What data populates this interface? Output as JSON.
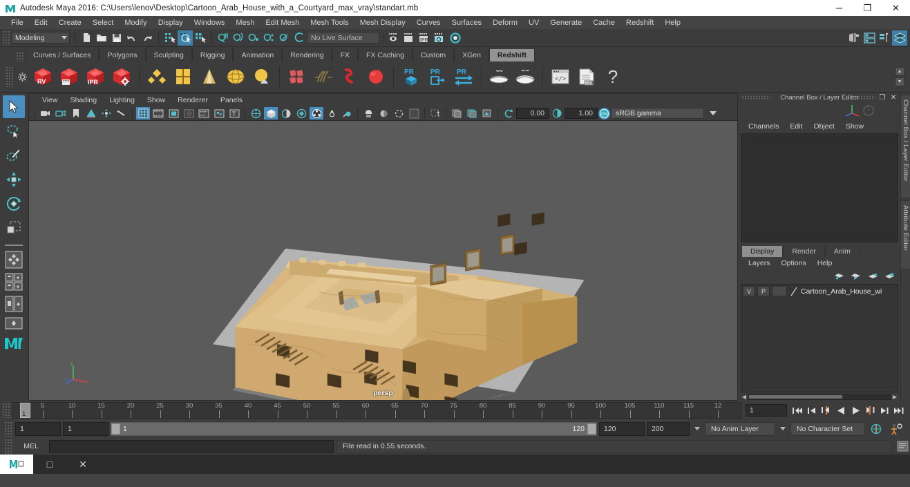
{
  "titlebar": {
    "text": "Autodesk Maya 2016: C:\\Users\\lenov\\Desktop\\Cartoon_Arab_House_with_a_Courtyard_max_vray\\standart.mb",
    "icon": "maya-app-icon",
    "minimize": "─",
    "maximize": "❐",
    "close": "✕"
  },
  "menubar": {
    "items": [
      {
        "label": "File"
      },
      {
        "label": "Edit"
      },
      {
        "label": "Create"
      },
      {
        "label": "Select"
      },
      {
        "label": "Modify"
      },
      {
        "label": "Display"
      },
      {
        "label": "Windows"
      },
      {
        "label": "Mesh"
      },
      {
        "label": "Edit Mesh"
      },
      {
        "label": "Mesh Tools"
      },
      {
        "label": "Mesh Display"
      },
      {
        "label": "Curves"
      },
      {
        "label": "Surfaces"
      },
      {
        "label": "Deform"
      },
      {
        "label": "UV"
      },
      {
        "label": "Generate"
      },
      {
        "label": "Cache"
      },
      {
        "label": "Redshift"
      },
      {
        "label": "Help"
      }
    ]
  },
  "statusbar": {
    "menuset": "Modeling",
    "live_surface": "No Live Surface",
    "icons": [
      "new-scene-icon",
      "open-scene-icon",
      "save-scene-icon",
      "undo-icon",
      "redo-icon",
      "select-by-hierarchy-icon",
      "select-by-object-icon",
      "select-by-component-icon",
      "snap-to-grid-icon",
      "snap-to-curve-icon",
      "snap-to-point-icon",
      "snap-to-projected-center-icon",
      "snap-to-view-plane-icon",
      "make-live-icon",
      "show-render-view-icon",
      "render-current-frame-icon",
      "ipr-render-icon",
      "render-settings-icon",
      "hypershade-icon",
      "toggle-sidebar-icon",
      "attribute-editor-icon",
      "tool-settings-icon",
      "channel-box-icon"
    ]
  },
  "shelf": {
    "tabs": [
      {
        "label": "Curves / Surfaces",
        "active": false
      },
      {
        "label": "Polygons",
        "active": false
      },
      {
        "label": "Sculpting",
        "active": false
      },
      {
        "label": "Rigging",
        "active": false
      },
      {
        "label": "Animation",
        "active": false
      },
      {
        "label": "Rendering",
        "active": false
      },
      {
        "label": "FX",
        "active": false
      },
      {
        "label": "FX Caching",
        "active": false
      },
      {
        "label": "Custom",
        "active": false
      },
      {
        "label": "XGen",
        "active": false
      },
      {
        "label": "Redshift",
        "active": true
      }
    ],
    "buttons": [
      {
        "name": "redshift-render-view-icon",
        "badge": "RV"
      },
      {
        "name": "redshift-render-sequence-icon",
        "badge": ""
      },
      {
        "name": "redshift-ipr-icon",
        "badge": "IPR"
      },
      {
        "name": "redshift-render-settings-icon",
        "badge": ""
      },
      {
        "name": "redshift-area-light-icon",
        "badge": ""
      },
      {
        "name": "redshift-portal-light-icon",
        "badge": ""
      },
      {
        "name": "redshift-ies-light-icon",
        "badge": ""
      },
      {
        "name": "redshift-dome-light-icon",
        "badge": ""
      },
      {
        "name": "redshift-physical-sun-icon",
        "badge": ""
      },
      {
        "name": "redshift-proxy-icon",
        "badge": ""
      },
      {
        "name": "redshift-hair-icon",
        "badge": ""
      },
      {
        "name": "redshift-volume-icon",
        "badge": ""
      },
      {
        "name": "redshift-sphere-icon",
        "badge": ""
      },
      {
        "name": "redshift-pr-object-icon",
        "badge": "PR"
      },
      {
        "name": "redshift-pr-export-icon",
        "badge": "PR"
      },
      {
        "name": "redshift-pr-transfer-icon",
        "badge": "PR"
      },
      {
        "name": "redshift-bake-icon",
        "badge": ""
      },
      {
        "name": "redshift-bake-all-icon",
        "badge": ""
      },
      {
        "name": "redshift-script-editor-icon",
        "badge": ""
      },
      {
        "name": "redshift-log-icon",
        "badge": "LOG"
      },
      {
        "name": "redshift-help-icon",
        "badge": "?"
      }
    ]
  },
  "toolbox": {
    "tools": [
      {
        "name": "select-tool",
        "selected": true
      },
      {
        "name": "lasso-select-tool",
        "selected": false
      },
      {
        "name": "paint-select-tool",
        "selected": false
      },
      {
        "name": "move-tool",
        "selected": false
      },
      {
        "name": "rotate-tool",
        "selected": false
      },
      {
        "name": "scale-tool",
        "selected": false
      },
      {
        "name": "four-view-layout-icon",
        "selected": false
      },
      {
        "name": "persp-outliner-layout-icon",
        "selected": false
      },
      {
        "name": "persp-graph-layout-icon",
        "selected": false
      },
      {
        "name": "single-perspective-layout-icon",
        "selected": false
      },
      {
        "name": "maya-logo-icon",
        "selected": false
      }
    ]
  },
  "viewport": {
    "menu": [
      "View",
      "Shading",
      "Lighting",
      "Show",
      "Renderer",
      "Panels"
    ],
    "camera_label": "persp",
    "exposure": "0.00",
    "gamma_value": "1.00",
    "color_profile": "sRGB gamma",
    "toolbar_icons": [
      "camera-select-icon",
      "camera-attributes-icon",
      "bookmark-icon",
      "image-plane-icon",
      "two-d-pan-zoom-icon",
      "oculus-icon",
      "grid-toggle-icon",
      "film-gate-icon",
      "resolution-gate-icon",
      "gate-mask-icon",
      "film-origin-icon",
      "safe-action-icon",
      "safe-title-icon",
      "wireframe-shading-icon",
      "smooth-shade-all-icon",
      "smooth-shade-selected-icon",
      "flat-shade-icon",
      "wireframe-on-shaded-icon",
      "xray-icon",
      "xray-joints-icon",
      "use-default-lighting-icon",
      "use-all-lights-icon",
      "shadows-icon",
      "ao-icon",
      "motion-blur-icon",
      "multisample-icon",
      "depth-of-field-icon",
      "isolate-select-icon",
      "grid-display-icon",
      "gpu-cache-icon",
      "exposure-icon",
      "gamma-icon",
      "color-management-icon"
    ]
  },
  "channelbox": {
    "title": "Channel Box / Layer Editor",
    "float_btn": "❐",
    "close_btn": "✕",
    "menu": [
      "Channels",
      "Edit",
      "Object",
      "Show"
    ],
    "side_tabs": [
      "Channel Box / Layer Editor",
      "Attribute Editor"
    ]
  },
  "layereditor": {
    "tabs": [
      {
        "label": "Display",
        "active": true
      },
      {
        "label": "Render",
        "active": false
      },
      {
        "label": "Anim",
        "active": false
      }
    ],
    "menu": [
      "Layers",
      "Options",
      "Help"
    ],
    "toolbar_icons": [
      "layer-move-up-icon",
      "layer-move-down-icon",
      "layer-new-icon",
      "layer-new-from-selected-icon"
    ],
    "rows": [
      {
        "visibility": "V",
        "playback": "P",
        "shading": "",
        "name": "Cartoon_Arab_House_wi"
      }
    ]
  },
  "timeslider": {
    "current_frame": "1",
    "current_frame_field": "1",
    "ticks": [
      {
        "label": "5",
        "frame": 5
      },
      {
        "label": "10",
        "frame": 10
      },
      {
        "label": "15",
        "frame": 15
      },
      {
        "label": "20",
        "frame": 20
      },
      {
        "label": "25",
        "frame": 25
      },
      {
        "label": "30",
        "frame": 30
      },
      {
        "label": "35",
        "frame": 35
      },
      {
        "label": "40",
        "frame": 40
      },
      {
        "label": "45",
        "frame": 45
      },
      {
        "label": "50",
        "frame": 50
      },
      {
        "label": "55",
        "frame": 55
      },
      {
        "label": "60",
        "frame": 60
      },
      {
        "label": "65",
        "frame": 65
      },
      {
        "label": "70",
        "frame": 70
      },
      {
        "label": "75",
        "frame": 75
      },
      {
        "label": "80",
        "frame": 80
      },
      {
        "label": "85",
        "frame": 85
      },
      {
        "label": "90",
        "frame": 90
      },
      {
        "label": "95",
        "frame": 95
      },
      {
        "label": "100",
        "frame": 100
      },
      {
        "label": "105",
        "frame": 105
      },
      {
        "label": "110",
        "frame": 110
      },
      {
        "label": "115",
        "frame": 115
      },
      {
        "label": "12",
        "frame": 120
      }
    ],
    "playback_buttons": [
      "go-to-start-icon",
      "step-back-keyframe-icon",
      "step-back-frame-icon",
      "play-backwards-icon",
      "play-forwards-icon",
      "step-forward-frame-icon",
      "step-forward-keyframe-icon",
      "go-to-end-icon"
    ]
  },
  "rangeslider": {
    "anim_start": "1",
    "range_start": "1",
    "bar_start_label": "1",
    "bar_end_label": "120",
    "range_end": "120",
    "anim_end": "200",
    "anim_layer": "No Anim Layer",
    "character_set": "No Character Set",
    "auto_key_icon": "auto-keyframe-icon",
    "anim_prefs_icon": "animation-preferences-icon"
  },
  "commandline": {
    "language_label": "MEL",
    "input_value": "",
    "message": "File read in  0.55 seconds.",
    "script_editor_icon": "script-editor-icon"
  },
  "taskbar": {
    "items": [
      {
        "name": "maya-taskbar-item",
        "active": true
      },
      {
        "name": "taskbar-window-item",
        "label": "□",
        "active": false
      },
      {
        "name": "taskbar-close-item",
        "label": "✕",
        "active": false
      }
    ]
  },
  "colors": {
    "accent_blue": "#4a8fc0",
    "shelf_active": "#939393",
    "panel_bg": "#3c3c3c",
    "viewport_bg": "#5b5b5b",
    "model_wall": "#e0bf8a",
    "redshift_red": "#e2383b",
    "teal": "#3fb6c0"
  }
}
